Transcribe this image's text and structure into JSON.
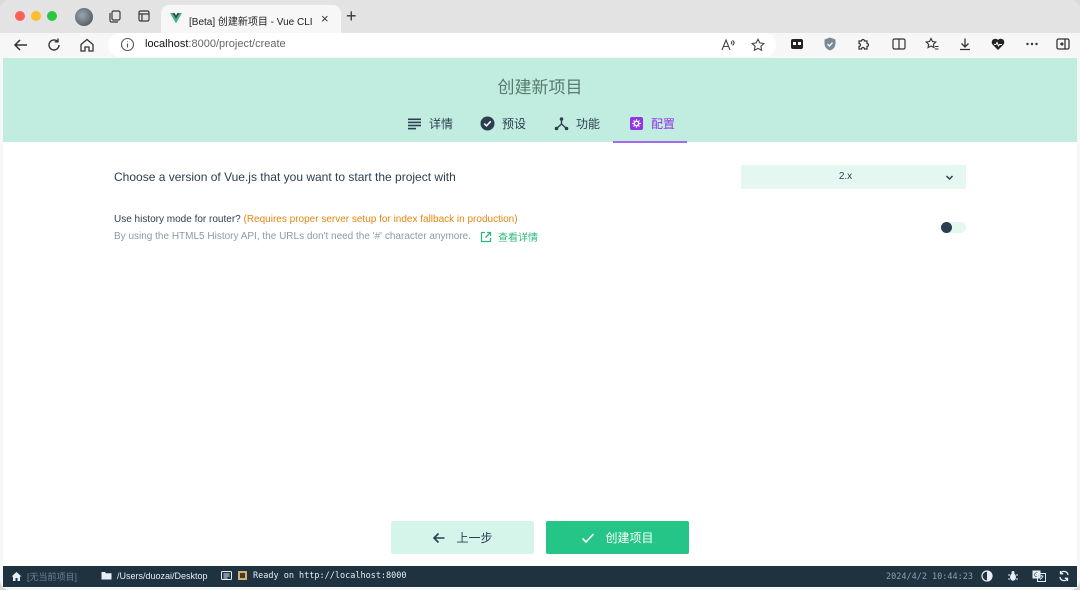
{
  "browser": {
    "tab_title": "[Beta] 创建新项目 - Vue CLI",
    "tab_close": "×",
    "new_tab": "+",
    "url_host": "localhost",
    "url_path": ":8000/project/create"
  },
  "page": {
    "title": "创建新项目",
    "steps": [
      {
        "label": "详情",
        "icon": "list-icon"
      },
      {
        "label": "预设",
        "icon": "check-circle-icon"
      },
      {
        "label": "功能",
        "icon": "fork-icon"
      },
      {
        "label": "配置",
        "icon": "settings-icon",
        "active": true
      }
    ],
    "vue_version": {
      "label": "Choose a version of Vue.js that you want to start the project with",
      "selected": "2.x"
    },
    "history_mode": {
      "label": "Use history mode for router?",
      "warning": "(Requires proper server setup for index fallback in production)",
      "description": "By using the HTML5 History API, the URLs don't need the '#' character anymore.",
      "more_link": "查看详情",
      "enabled": false
    },
    "buttons": {
      "prev": "上一步",
      "create": "创建项目"
    }
  },
  "statusbar": {
    "project": "[无当前项目]",
    "path": "/Users/duozai/Desktop",
    "log": "Ready on http://localhost:8000",
    "datetime": "2024/4/2 10:44:23"
  },
  "colors": {
    "accent_green": "#25c487",
    "hero_bg": "#c0ede0",
    "active_step": "#9334e6",
    "warning": "#e8850e",
    "statusbar_bg": "#1f3240"
  }
}
